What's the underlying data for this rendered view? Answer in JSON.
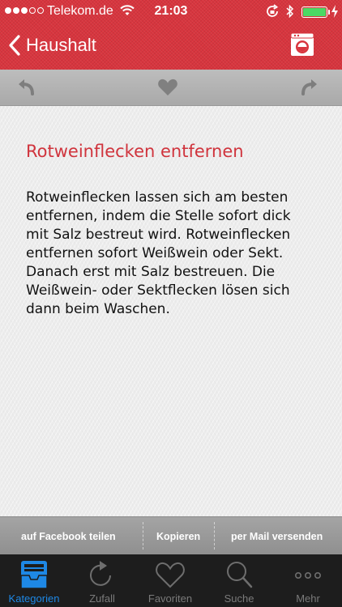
{
  "status_bar": {
    "carrier": "Telekom.de",
    "time": "21:03",
    "signal_bars": 3
  },
  "nav": {
    "back_label": "Haushalt",
    "right_icon": "washing-machine-icon"
  },
  "toolbar": {
    "icons": [
      "undo-arrow-icon",
      "heart-icon",
      "redo-arrow-icon"
    ]
  },
  "article": {
    "title": "Rotweinflecken entfernen",
    "lines": [
      "Rotweinflecken lassen sich am besten",
      "entfernen, indem die Stelle sofort dick",
      "mit Salz bestreut wird. Rotweinflecken",
      "entfernen sofort Weißwein oder Sekt.",
      "Danach erst mit Salz bestreuen. Die",
      "Weißwein- oder Sektflecken lösen sich",
      "dann beim Waschen."
    ]
  },
  "share_bar": {
    "facebook": "auf Facebook teilen",
    "copy": "Kopieren",
    "mail": "per Mail versenden"
  },
  "tabs": [
    {
      "label": "Kategorien",
      "icon": "inbox-tray-icon",
      "active": true
    },
    {
      "label": "Zufall",
      "icon": "refresh-play-icon",
      "active": false
    },
    {
      "label": "Favoriten",
      "icon": "heart-outline-icon",
      "active": false
    },
    {
      "label": "Suche",
      "icon": "search-icon",
      "active": false
    },
    {
      "label": "Mehr",
      "icon": "more-dots-icon",
      "active": false
    }
  ],
  "colors": {
    "header_red": "#d8353e",
    "title_red": "#d0343d",
    "active_tab_blue": "#1e88e5",
    "battery_green": "#4cd964"
  }
}
